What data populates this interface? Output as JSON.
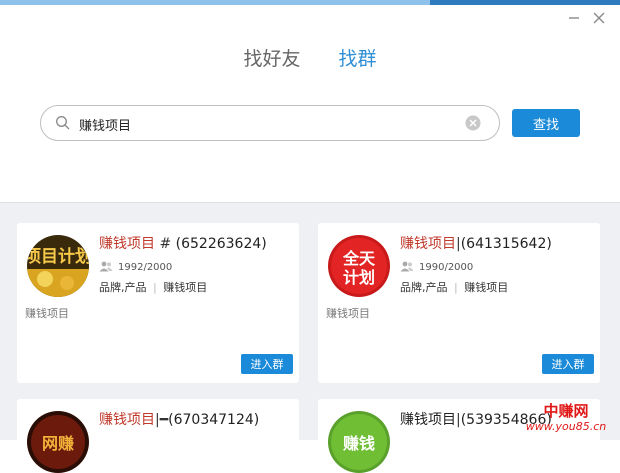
{
  "tabs": [
    {
      "label": "找好友"
    },
    {
      "label": "找群"
    }
  ],
  "search": {
    "value": "赚钱项目",
    "button_label": "查找"
  },
  "results": [
    {
      "name": "赚钱项目",
      "separator": "#",
      "number": "(652263624)",
      "members": "1992/2000",
      "tag1": "品牌,产品",
      "tag2": "赚钱项目",
      "desc": "赚钱项目",
      "join_label": "进入群",
      "avatar_text": "项目计划"
    },
    {
      "name": "赚钱项目",
      "separator": "|",
      "number": "(641315642)",
      "members": "1990/2000",
      "tag1": "品牌,产品",
      "tag2": "赚钱项目",
      "desc": "赚钱项目",
      "join_label": "进入群",
      "avatar_text": "全天计划"
    },
    {
      "name": "赚钱项目",
      "separator": "|━",
      "number": "(670347124)",
      "avatar_text": "网赚"
    },
    {
      "name": "赚钱项目",
      "separator": "|",
      "number": "(539354866)",
      "avatar_text": "赚钱"
    }
  ],
  "watermark": {
    "cn": "中赚网",
    "en": "www.you85.cn"
  },
  "colors": {
    "accent": "#1b8ad8",
    "tab_active": "#2f8fd6",
    "group_name": "#c0392b",
    "watermark": "#e01818"
  }
}
